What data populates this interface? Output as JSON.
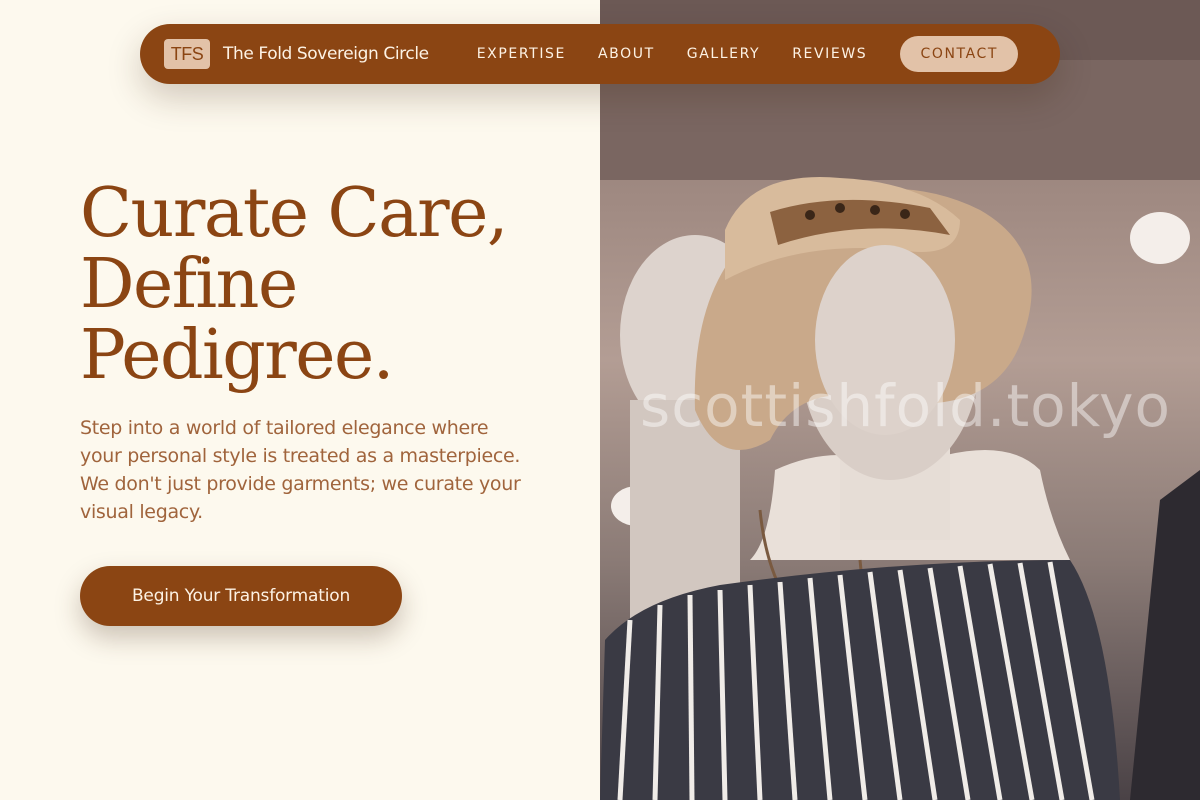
{
  "nav": {
    "brand_mark": "TFS",
    "brand_name": "The Fold Sovereign Circle",
    "links": [
      {
        "label": "EXPERTISE"
      },
      {
        "label": "ABOUT"
      },
      {
        "label": "GALLERY"
      },
      {
        "label": "REVIEWS"
      }
    ],
    "contact_label": "CONTACT"
  },
  "hero": {
    "headline_lines": [
      "Curate Care,",
      "Define",
      "Pedigree."
    ],
    "subcopy": "Step into a world of tailored elegance where your personal style is treated as a masterpiece. We don't just provide garments; we curate your visual legacy.",
    "cta_label": "Begin Your Transformation"
  },
  "image": {
    "watermark": "scottishfold.tokyo",
    "subject": "mannequin-with-straw-hat"
  },
  "colors": {
    "brand": "#8b4513",
    "accent": "#e2c2a8",
    "background": "#fdf9ee",
    "text_muted": "#a0643c"
  }
}
